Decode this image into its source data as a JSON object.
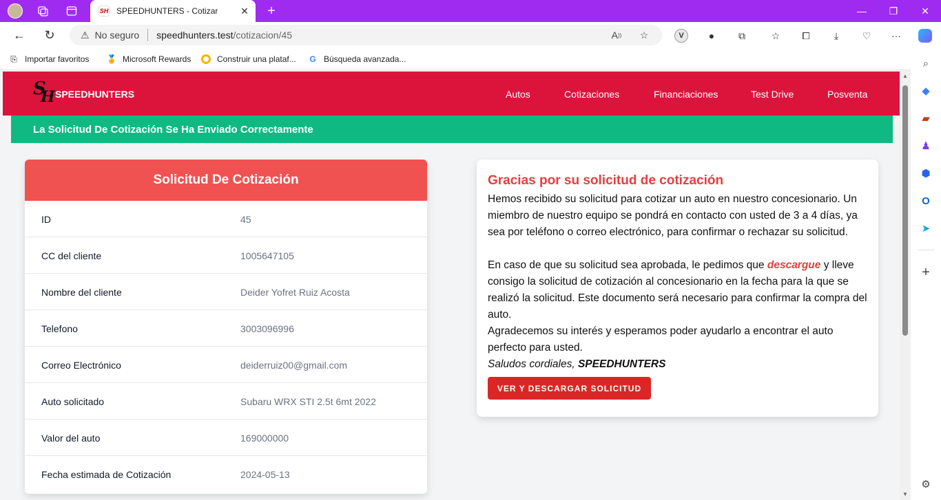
{
  "browser": {
    "tab_title": "SPEEDHUNTERS - Cotizar",
    "not_secure": "No seguro",
    "url_host": "speedhunters.test",
    "url_path": "/cotizacion/45",
    "favorites": [
      {
        "label": "Importar favoritos"
      },
      {
        "label": "Microsoft Rewards"
      },
      {
        "label": "Construir una plataf..."
      },
      {
        "label": "Búsqueda avanzada..."
      }
    ]
  },
  "site": {
    "brand": "SPEEDHUNTERS",
    "logo_text": "SH",
    "nav": [
      "Autos",
      "Cotizaciones",
      "Financiaciones",
      "Test Drive",
      "Posventa"
    ]
  },
  "alert": {
    "text": "La Solicitud De Cotización Se Ha Enviado Correctamente",
    "color": "#10b981"
  },
  "quote": {
    "title": "Solicitud De Cotización",
    "rows": [
      {
        "label": "ID",
        "value": "45"
      },
      {
        "label": "CC del cliente",
        "value": "1005647105"
      },
      {
        "label": "Nombre del cliente",
        "value": "Deider Yofret Ruiz Acosta"
      },
      {
        "label": "Telefono",
        "value": "3003096996"
      },
      {
        "label": "Correo Electrónico",
        "value": "deiderruiz00@gmail.com"
      },
      {
        "label": "Auto solicitado",
        "value": "Subaru WRX STI 2.5t 6mt 2022"
      },
      {
        "label": "Valor del auto",
        "value": "169000000"
      },
      {
        "label": "Fecha estimada de Cotización",
        "value": "2024-05-13"
      }
    ]
  },
  "thanks": {
    "title": "Gracias por su solicitud de cotización",
    "p1": "Hemos recibido su solicitud para cotizar un auto en nuestro concesionario. Un miembro de nuestro equipo se pondrá en contacto con usted de 3 a 4 días, ya sea por teléfono o correo electrónico, para confirmar o rechazar su solicitud.",
    "p2_before": "En caso de que su solicitud sea aprobada, le pedimos que ",
    "p2_link": "descargue",
    "p2_after": " y lleve consigo la solicitud de cotización al concesionario en la fecha para la que se realizó la solicitud. Este documento será necesario para confirmar la compra del auto.",
    "p3": "Agradecemos su interés y esperamos poder ayudarlo a encontrar el auto perfecto para usted.",
    "signoff": "Saludos cordiales, ",
    "signoff_brand": "SPEEDHUNTERS",
    "button": "VER Y DESCARGAR SOLICITUD"
  },
  "colors": {
    "tabbar": "#a02bf0",
    "nav": "#dc143c",
    "card_header": "#f05252",
    "button": "#dc2626"
  }
}
